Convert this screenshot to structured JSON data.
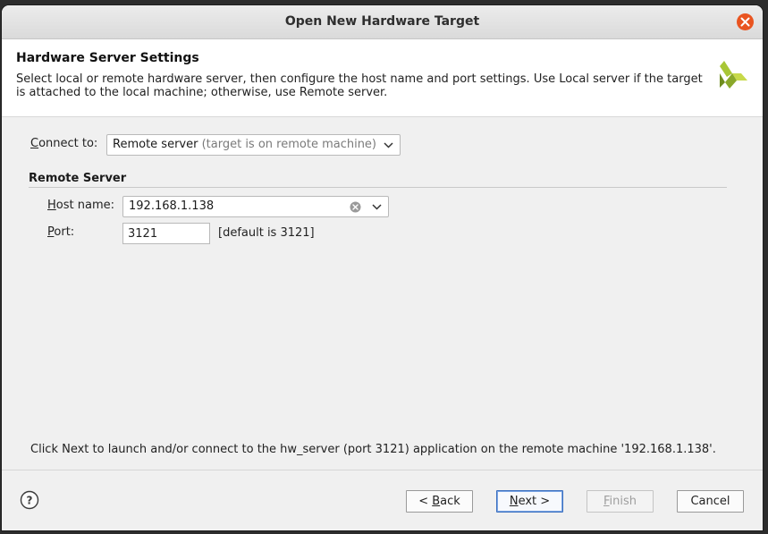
{
  "window": {
    "title": "Open New Hardware Target"
  },
  "header": {
    "title": "Hardware Server Settings",
    "description": "Select local or remote hardware server, then configure the host name and port settings. Use Local server if the target is attached to the local machine; otherwise, use Remote server."
  },
  "connect": {
    "label_prefix": "C",
    "label_rest": "onnect to:",
    "selected": "Remote server",
    "selected_hint": "(target is on remote machine)"
  },
  "remote_server": {
    "section_title": "Remote Server",
    "host_label_prefix": "H",
    "host_label_rest": "ost name:",
    "host_value": "192.168.1.138",
    "port_label_prefix": "P",
    "port_label_rest": "ort:",
    "port_value": "3121",
    "port_default_note": "[default is 3121]"
  },
  "info_message": "Click Next to launch and/or connect to the hw_server (port 3121) application on the remote machine '192.168.1.138'.",
  "buttons": {
    "back_prefix": "< ",
    "back_mnemonic": "B",
    "back_rest": "ack",
    "next_mnemonic": "N",
    "next_rest": "ext >",
    "finish_mnemonic": "F",
    "finish_rest": "inish",
    "cancel": "Cancel"
  },
  "icons": {
    "close": "close-icon",
    "logo": "xilinx-logo-icon",
    "chevron": "chevron-down-icon",
    "clear": "clear-icon",
    "help": "help-icon"
  },
  "colors": {
    "close_button": "#e95420",
    "logo_green": "#9bbb2a",
    "primary_border": "#3b6fbf"
  }
}
